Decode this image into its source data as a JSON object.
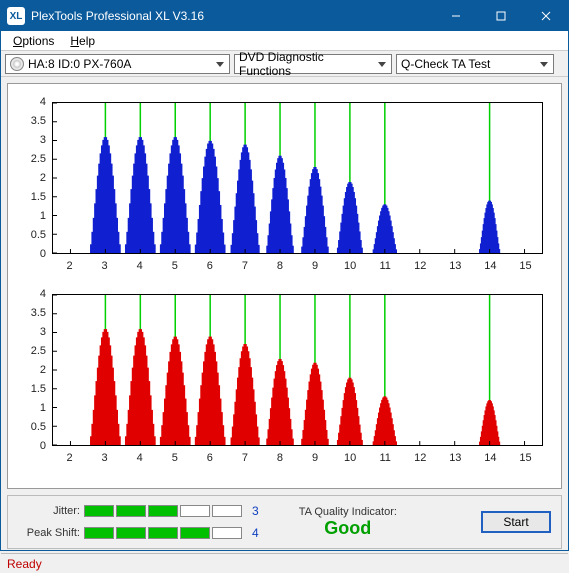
{
  "window": {
    "title": "PlexTools Professional XL V3.16"
  },
  "menu": {
    "options": "Options",
    "help": "Help"
  },
  "toolbar": {
    "device": "HA:8 ID:0   PX-760A",
    "category": "DVD Diagnostic Functions",
    "test": "Q-Check TA Test"
  },
  "chart_data": [
    {
      "type": "bar_distribution",
      "color": "#1020d0",
      "ylim": [
        0,
        4
      ],
      "xlim": [
        1.5,
        15.5
      ],
      "y_ticks": [
        0,
        0.5,
        1,
        1.5,
        2,
        2.5,
        3,
        3.5,
        4
      ],
      "x_ticks": [
        2,
        3,
        4,
        5,
        6,
        7,
        8,
        9,
        10,
        11,
        12,
        13,
        14,
        15
      ],
      "gridlines_x": [
        3,
        4,
        5,
        6,
        7,
        8,
        9,
        10,
        11,
        14
      ],
      "peaks": [
        {
          "center": 3,
          "height": 3.1,
          "width": 0.9
        },
        {
          "center": 4,
          "height": 3.1,
          "width": 0.9
        },
        {
          "center": 5,
          "height": 3.1,
          "width": 0.9
        },
        {
          "center": 6,
          "height": 3.0,
          "width": 0.9
        },
        {
          "center": 7,
          "height": 2.9,
          "width": 0.85
        },
        {
          "center": 8,
          "height": 2.6,
          "width": 0.8
        },
        {
          "center": 9,
          "height": 2.3,
          "width": 0.8
        },
        {
          "center": 10,
          "height": 1.9,
          "width": 0.75
        },
        {
          "center": 11,
          "height": 1.3,
          "width": 0.7
        },
        {
          "center": 14,
          "height": 1.4,
          "width": 0.6
        }
      ]
    },
    {
      "type": "bar_distribution",
      "color": "#e00000",
      "ylim": [
        0,
        4
      ],
      "xlim": [
        1.5,
        15.5
      ],
      "y_ticks": [
        0,
        0.5,
        1,
        1.5,
        2,
        2.5,
        3,
        3.5,
        4
      ],
      "x_ticks": [
        2,
        3,
        4,
        5,
        6,
        7,
        8,
        9,
        10,
        11,
        12,
        13,
        14,
        15
      ],
      "gridlines_x": [
        3,
        4,
        5,
        6,
        7,
        8,
        9,
        10,
        11,
        14
      ],
      "peaks": [
        {
          "center": 3,
          "height": 3.1,
          "width": 0.9
        },
        {
          "center": 4,
          "height": 3.1,
          "width": 0.9
        },
        {
          "center": 5,
          "height": 2.9,
          "width": 0.9
        },
        {
          "center": 6,
          "height": 2.9,
          "width": 0.9
        },
        {
          "center": 7,
          "height": 2.7,
          "width": 0.85
        },
        {
          "center": 8,
          "height": 2.3,
          "width": 0.8
        },
        {
          "center": 9,
          "height": 2.2,
          "width": 0.8
        },
        {
          "center": 10,
          "height": 1.8,
          "width": 0.75
        },
        {
          "center": 11,
          "height": 1.3,
          "width": 0.7
        },
        {
          "center": 14,
          "height": 1.2,
          "width": 0.6
        }
      ]
    }
  ],
  "meters": {
    "jitter": {
      "label": "Jitter:",
      "value": "3",
      "segments": 5,
      "filled": 3
    },
    "peakshift": {
      "label": "Peak Shift:",
      "value": "4",
      "segments": 5,
      "filled": 4
    }
  },
  "quality": {
    "label": "TA Quality Indicator:",
    "value": "Good"
  },
  "buttons": {
    "start": "Start"
  },
  "status": "Ready"
}
